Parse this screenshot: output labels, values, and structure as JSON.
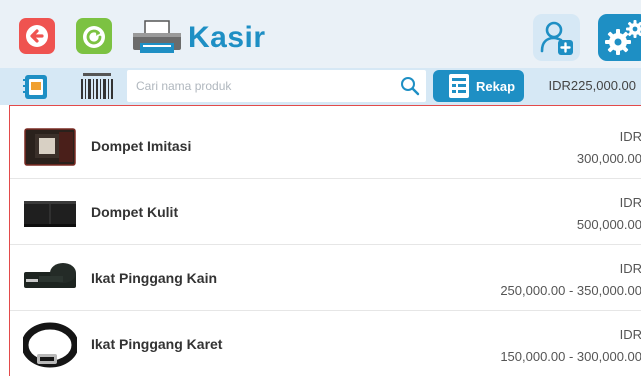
{
  "header": {
    "title": "Kasir"
  },
  "toolbar": {
    "search_placeholder": "Cari nama produk",
    "rekap_label": "Rekap",
    "total": "IDR225,000.00"
  },
  "products": [
    {
      "name": "Dompet Imitasi",
      "currency": "IDR",
      "price": "300,000.00"
    },
    {
      "name": "Dompet Kulit",
      "currency": "IDR",
      "price": "500,000.00"
    },
    {
      "name": "Ikat Pinggang Kain",
      "currency": "IDR",
      "price": "250,000.00 - 350,000.00"
    },
    {
      "name": "Ikat Pinggang Karet",
      "currency": "IDR",
      "price": "150,000.00 - 300,000.00"
    }
  ],
  "colors": {
    "accent": "#1e8fc4",
    "back_button": "#ef5350",
    "refresh_button": "#7cc242",
    "header_bg": "#eaf1f7",
    "toolbar_bg": "#d6e8f5",
    "list_border": "#e34a4a"
  },
  "icons": [
    "back-icon",
    "refresh-icon",
    "printer-icon",
    "add-user-icon",
    "settings-icon",
    "book-icon",
    "barcode-icon",
    "search-icon",
    "rekap-icon"
  ]
}
